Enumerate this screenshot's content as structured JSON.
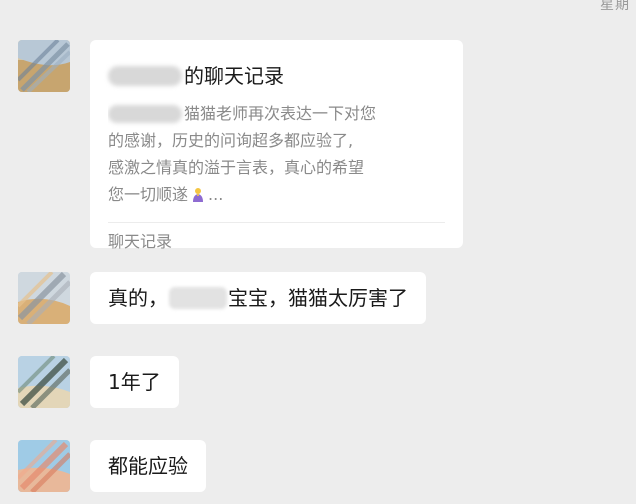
{
  "header": {
    "corner_fragment": "星期"
  },
  "messages": {
    "card": {
      "title_suffix": "的聊天记录",
      "preview_line1": "猫猫老师再次表达一下对您",
      "preview_line2": "的感谢，历史的问询超多都应验了,",
      "preview_line3": "感激之情真的溢于言表，真心的希望",
      "preview_line4_before": "您一切顺遂",
      "preview_line4_after": "...",
      "footer": "聊天记录",
      "emoji_icon": "praying-hands-icon"
    },
    "msg2": {
      "before": "真的，",
      "after": "宝宝，猫猫太厉害了"
    },
    "msg3": {
      "text": "1年了"
    },
    "msg4": {
      "text": "都能应验"
    }
  },
  "colors": {
    "background": "#ededed",
    "bubble": "#ffffff",
    "muted_text": "#8a8a8a"
  }
}
